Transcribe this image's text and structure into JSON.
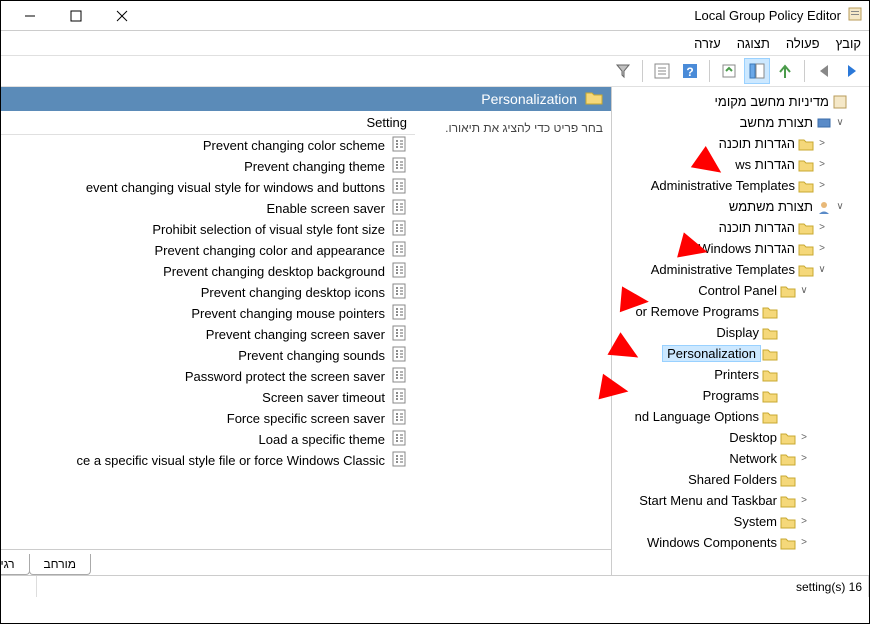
{
  "title": "Local Group Policy Editor",
  "menus": [
    "קובץ",
    "פעולה",
    "תצוגה",
    "עזרה"
  ],
  "tree": {
    "root": "מדיניות מחשב מקומי",
    "computer": "תצורת מחשב",
    "comp_software": "הגדרות תוכנה",
    "comp_windows": "הגדרות ws",
    "comp_admin": "Administrative Templates",
    "user": "תצורת משתמש",
    "user_software": "הגדרות תוכנה",
    "user_windows": "הגדרות Windows",
    "user_admin": "Administrative Templates",
    "control_panel": "Control Panel",
    "add_remove": "or Remove Programs",
    "display": "Display",
    "personalization": "Personalization",
    "printers": "Printers",
    "programs": "Programs",
    "regional": "nd Language Options",
    "desktop": "Desktop",
    "network": "Network",
    "shared": "Shared Folders",
    "startmenu": "Start Menu and Taskbar",
    "system": "System",
    "wincomp": "Windows Components"
  },
  "content_header": "Personalization",
  "desc_text": "בחר פריט כדי להציג את תיאורו.",
  "list_header": "Setting",
  "settings": [
    "Prevent changing color scheme",
    "Prevent changing theme",
    "event changing visual style for windows and buttons",
    "Enable screen saver",
    "Prohibit selection of visual style font size",
    "Prevent changing color and appearance",
    "Prevent changing desktop background",
    "Prevent changing desktop icons",
    "Prevent changing mouse pointers",
    "Prevent changing screen saver",
    "Prevent changing sounds",
    "Password protect the screen saver",
    "Screen saver timeout",
    "Force specific screen saver",
    "Load a specific theme",
    "ce a specific visual style file or force Windows Classic"
  ],
  "tabs": {
    "extended": "מורחב",
    "standard": "רגיל"
  },
  "status_text": "setting(s) 16"
}
